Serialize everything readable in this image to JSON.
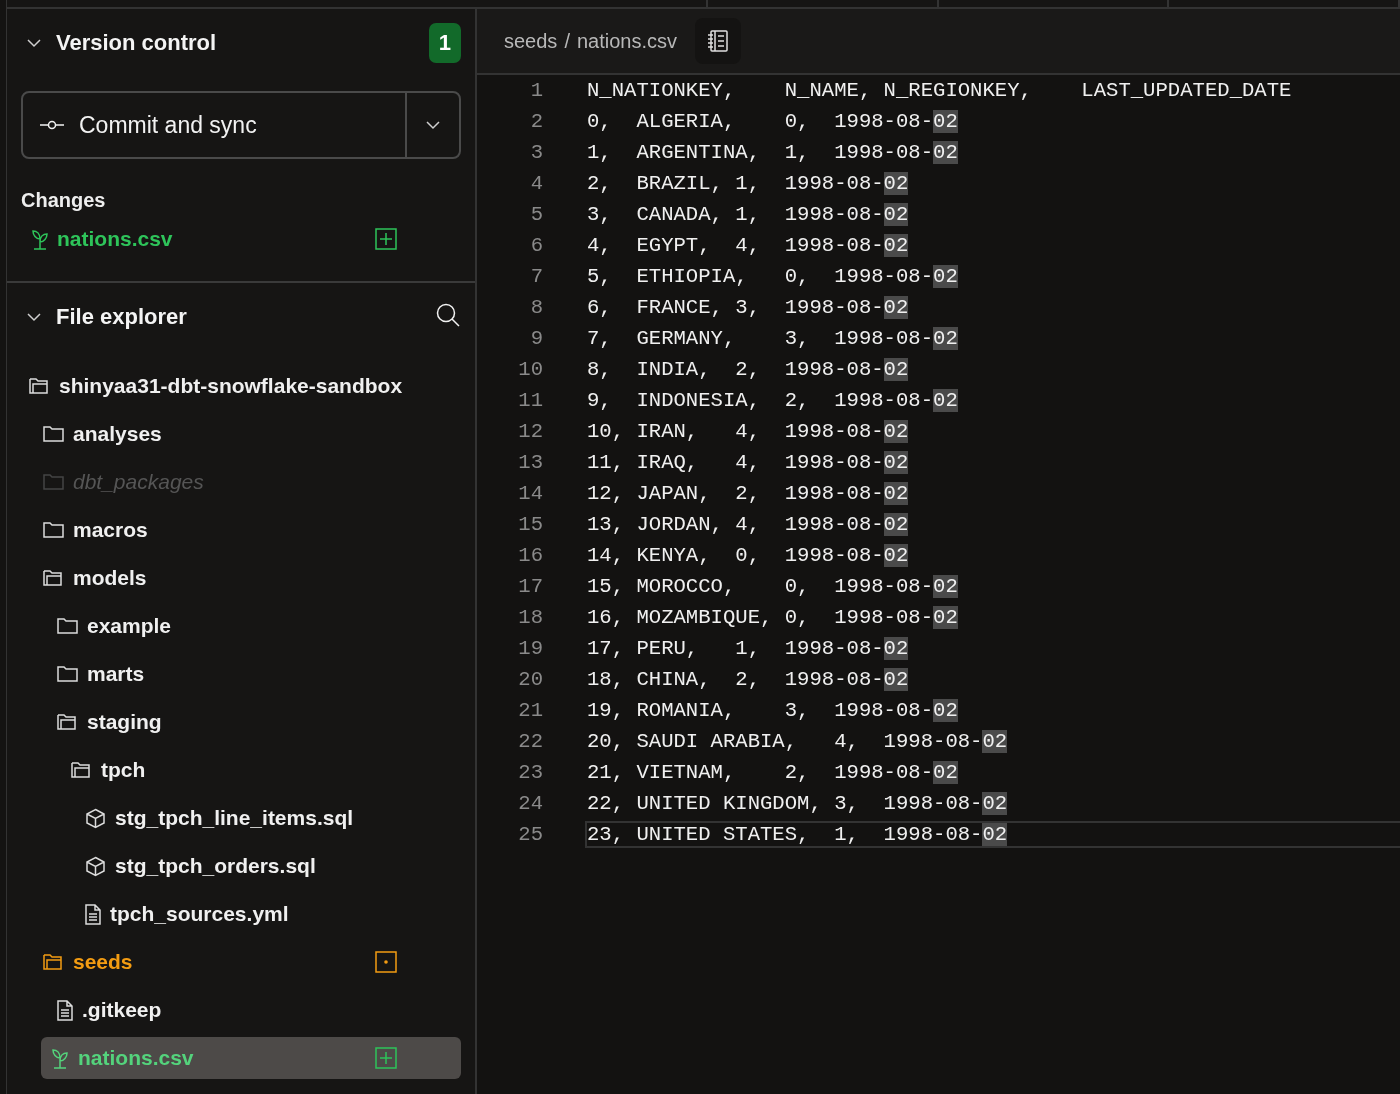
{
  "version_control": {
    "title": "Version control",
    "expanded": true,
    "badge": "1",
    "commit_button": "Commit and sync",
    "changes_label": "Changes",
    "changes": [
      {
        "name": "nations.csv",
        "kind": "seed",
        "added": true
      }
    ]
  },
  "file_explorer": {
    "title": "File explorer",
    "expanded": true,
    "tree": [
      {
        "name": "shinyaa31-dbt-snowflake-sandbox",
        "kind": "folder",
        "expanded": true,
        "children": [
          {
            "name": "analyses",
            "kind": "folder",
            "expanded": false
          },
          {
            "name": "dbt_packages",
            "kind": "folder",
            "expanded": false,
            "ignored": true
          },
          {
            "name": "macros",
            "kind": "folder",
            "expanded": false
          },
          {
            "name": "models",
            "kind": "folder",
            "expanded": true,
            "children": [
              {
                "name": "example",
                "kind": "folder",
                "expanded": false
              },
              {
                "name": "marts",
                "kind": "folder",
                "expanded": false
              },
              {
                "name": "staging",
                "kind": "folder",
                "expanded": true,
                "children": [
                  {
                    "name": "tpch",
                    "kind": "folder",
                    "expanded": true,
                    "children": [
                      {
                        "name": "stg_tpch_line_items.sql",
                        "kind": "model"
                      },
                      {
                        "name": "stg_tpch_orders.sql",
                        "kind": "model"
                      },
                      {
                        "name": "tpch_sources.yml",
                        "kind": "file"
                      }
                    ]
                  }
                ]
              }
            ]
          },
          {
            "name": "seeds",
            "kind": "folder",
            "expanded": true,
            "modified": true,
            "children": [
              {
                "name": ".gitkeep",
                "kind": "file"
              },
              {
                "name": "nations.csv",
                "kind": "seed",
                "added": true,
                "selected": true
              }
            ]
          }
        ]
      }
    ]
  },
  "editor": {
    "breadcrumb": [
      "seeds",
      "nations.csv"
    ],
    "breadcrumb_separator": "/",
    "lines": [
      {
        "number": "1",
        "text": "N_NATIONKEY,    N_NAME, N_REGIONKEY,    LAST_UPDATED_DATE",
        "current": false
      },
      {
        "number": "2",
        "text": "0,  ALGERIA,    0,  1998-08-",
        "highlight": "02",
        "current": false
      },
      {
        "number": "3",
        "text": "1,  ARGENTINA,  1,  1998-08-",
        "highlight": "02",
        "current": false
      },
      {
        "number": "4",
        "text": "2,  BRAZIL, 1,  1998-08-",
        "highlight": "02",
        "current": false
      },
      {
        "number": "5",
        "text": "3,  CANADA, 1,  1998-08-",
        "highlight": "02",
        "current": false
      },
      {
        "number": "6",
        "text": "4,  EGYPT,  4,  1998-08-",
        "highlight": "02",
        "current": false
      },
      {
        "number": "7",
        "text": "5,  ETHIOPIA,   0,  1998-08-",
        "highlight": "02",
        "current": false
      },
      {
        "number": "8",
        "text": "6,  FRANCE, 3,  1998-08-",
        "highlight": "02",
        "current": false
      },
      {
        "number": "9",
        "text": "7,  GERMANY,    3,  1998-08-",
        "highlight": "02",
        "current": false
      },
      {
        "number": "10",
        "text": "8,  INDIA,  2,  1998-08-",
        "highlight": "02",
        "current": false
      },
      {
        "number": "11",
        "text": "9,  INDONESIA,  2,  1998-08-",
        "highlight": "02",
        "current": false
      },
      {
        "number": "12",
        "text": "10, IRAN,   4,  1998-08-",
        "highlight": "02",
        "current": false
      },
      {
        "number": "13",
        "text": "11, IRAQ,   4,  1998-08-",
        "highlight": "02",
        "current": false
      },
      {
        "number": "14",
        "text": "12, JAPAN,  2,  1998-08-",
        "highlight": "02",
        "current": false
      },
      {
        "number": "15",
        "text": "13, JORDAN, 4,  1998-08-",
        "highlight": "02",
        "current": false
      },
      {
        "number": "16",
        "text": "14, KENYA,  0,  1998-08-",
        "highlight": "02",
        "current": false
      },
      {
        "number": "17",
        "text": "15, MOROCCO,    0,  1998-08-",
        "highlight": "02",
        "current": false
      },
      {
        "number": "18",
        "text": "16, MOZAMBIQUE, 0,  1998-08-",
        "highlight": "02",
        "current": false
      },
      {
        "number": "19",
        "text": "17, PERU,   1,  1998-08-",
        "highlight": "02",
        "current": false
      },
      {
        "number": "20",
        "text": "18, CHINA,  2,  1998-08-",
        "highlight": "02",
        "current": false
      },
      {
        "number": "21",
        "text": "19, ROMANIA,    3,  1998-08-",
        "highlight": "02",
        "current": false
      },
      {
        "number": "22",
        "text": "20, SAUDI ARABIA,   4,  1998-08-",
        "highlight": "02",
        "current": false
      },
      {
        "number": "23",
        "text": "21, VIETNAM,    2,  1998-08-",
        "highlight": "02",
        "current": false
      },
      {
        "number": "24",
        "text": "22, UNITED KINGDOM, 3,  1998-08-",
        "highlight": "02",
        "current": false
      },
      {
        "number": "25",
        "text": "23, UNITED STATES,  1,  1998-08-",
        "highlight": "02",
        "current": true
      }
    ]
  }
}
